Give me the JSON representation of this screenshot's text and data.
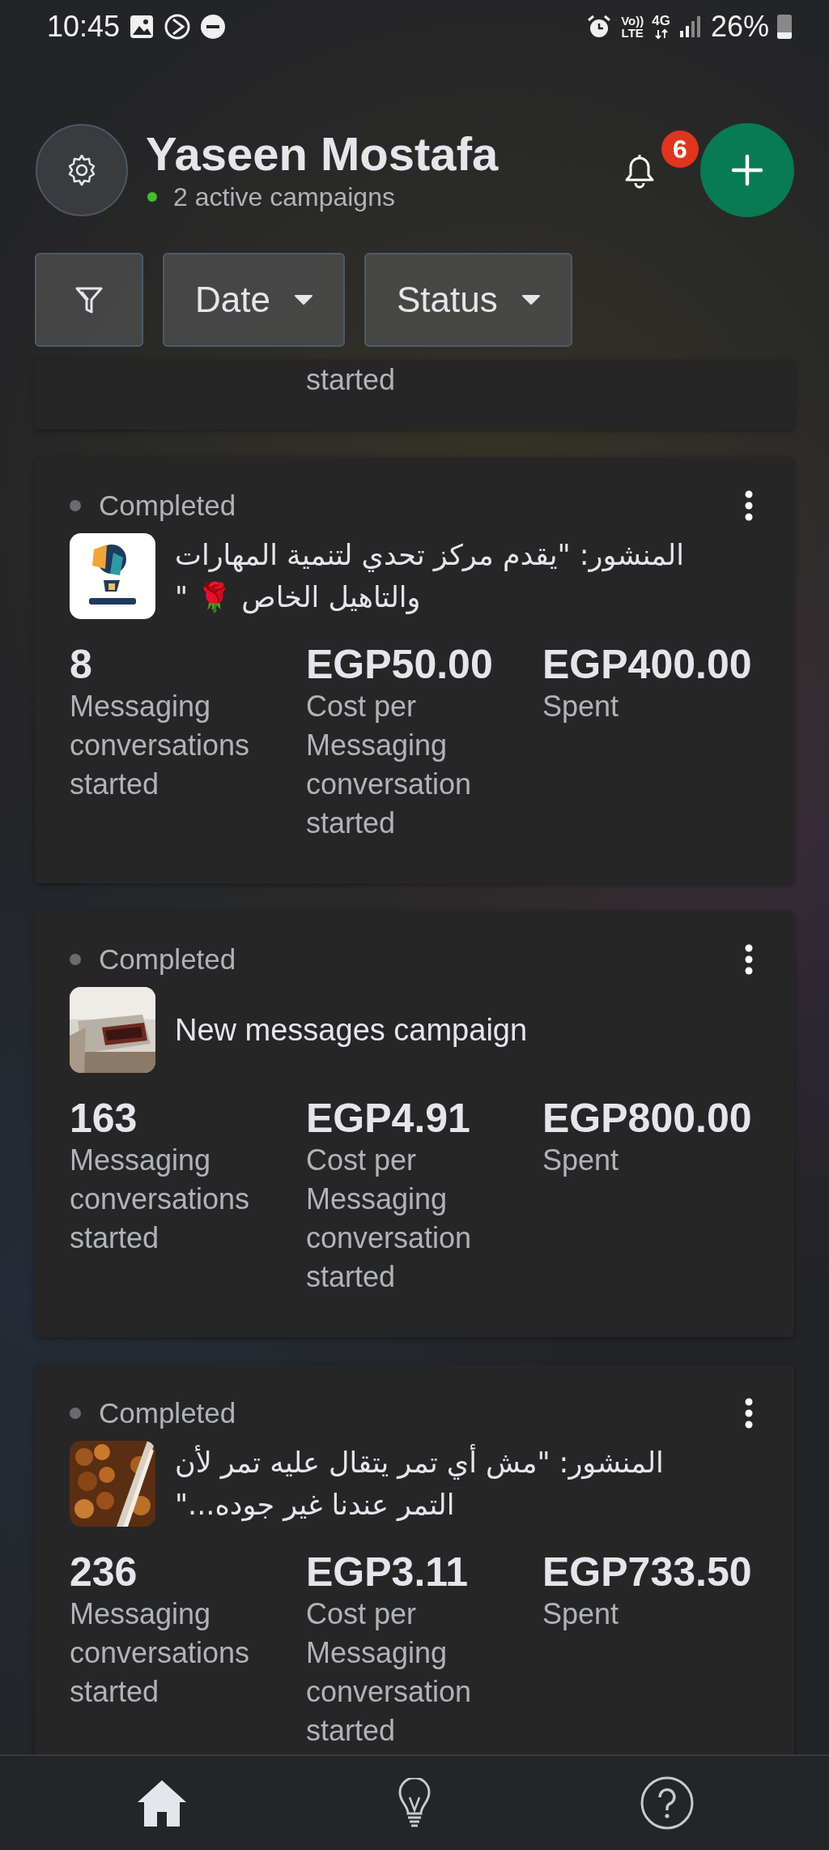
{
  "status_bar": {
    "time": "10:45",
    "volte": [
      "Vo))",
      "LTE"
    ],
    "network": "4G",
    "battery": "26%"
  },
  "header": {
    "name": "Yaseen Mostafa",
    "subtitle": "2 active campaigns",
    "notification_count": "6"
  },
  "filters": [
    {
      "kind": "icon"
    },
    {
      "kind": "dropdown",
      "label": "Date"
    },
    {
      "kind": "dropdown",
      "label": "Status"
    }
  ],
  "clipped_card": {
    "column_2": "started"
  },
  "campaigns": [
    {
      "status": "Completed",
      "title": "المنشور: \"يقدم مركز تحدي لتنمية المهارات والتاهيل الخاص 🌹 \"",
      "metrics": [
        {
          "value": "8",
          "label": "Messaging conversations started"
        },
        {
          "value": "EGP50.00",
          "label": "Cost per Messaging conversation started"
        },
        {
          "value": "EGP400.00",
          "label": "Spent"
        }
      ]
    },
    {
      "status": "Completed",
      "title": "New messages campaign",
      "metrics": [
        {
          "value": "163",
          "label": "Messaging conversations started"
        },
        {
          "value": "EGP4.91",
          "label": "Cost per Messaging conversation started"
        },
        {
          "value": "EGP800.00",
          "label": "Spent"
        }
      ]
    },
    {
      "status": "Completed",
      "title": "المنشور: \"مش أي تمر يتقال عليه تمر لأن التمر عندنا غير جوده...\"",
      "metrics": [
        {
          "value": "236",
          "label": "Messaging conversations started"
        },
        {
          "value": "EGP3.11",
          "label": "Cost per Messaging conversation started"
        },
        {
          "value": "EGP733.50",
          "label": "Spent"
        }
      ]
    }
  ],
  "bottom_nav": [
    {
      "kind": "home",
      "selected": true
    },
    {
      "kind": "tips",
      "selected": false
    },
    {
      "kind": "help",
      "selected": false
    }
  ]
}
